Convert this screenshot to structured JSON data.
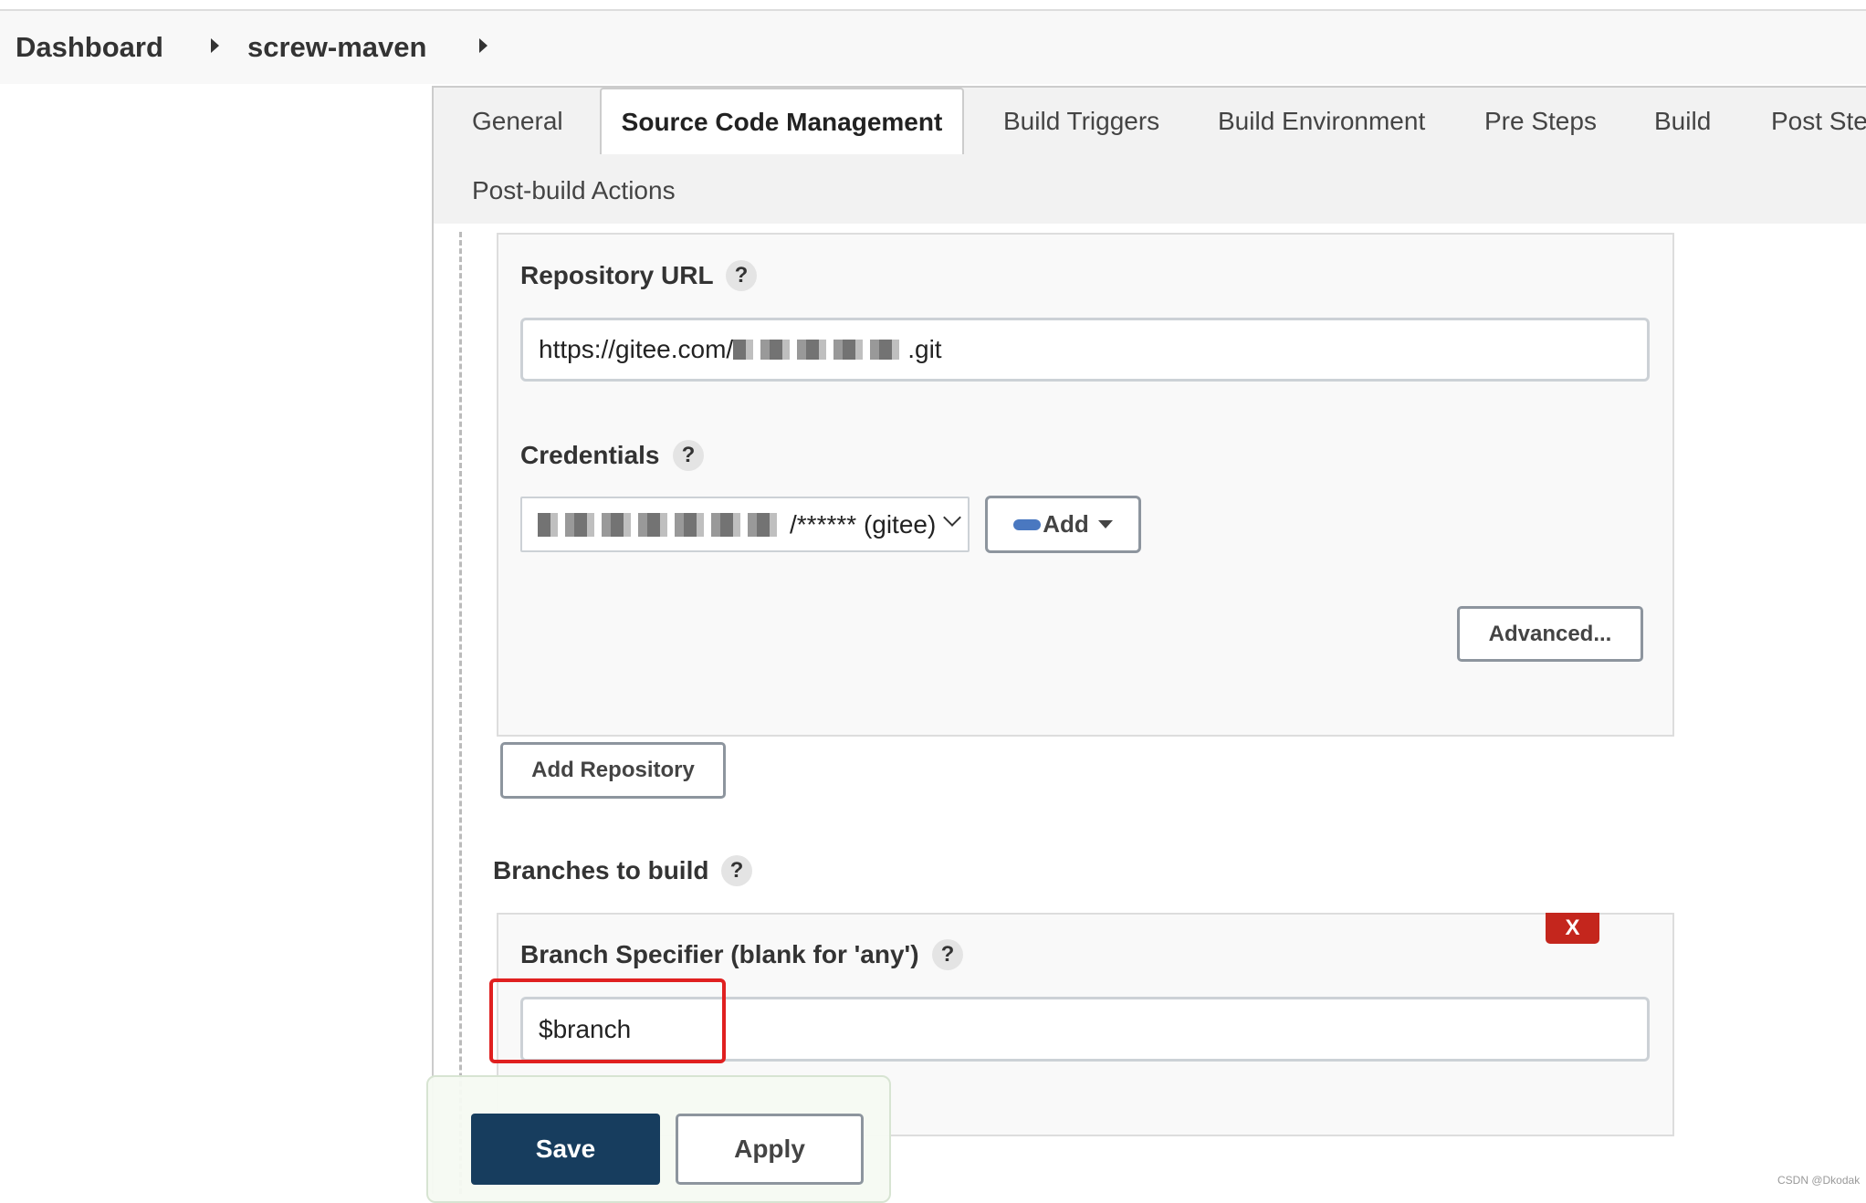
{
  "breadcrumb": {
    "items": [
      "Dashboard",
      "screw-maven"
    ]
  },
  "tabs": {
    "items": [
      "General",
      "Source Code Management",
      "Build Triggers",
      "Build Environment",
      "Pre Steps",
      "Build",
      "Post Ste",
      "Post-build Actions"
    ],
    "active": "Source Code Management"
  },
  "repository": {
    "url_label": "Repository URL",
    "url_value_prefix": "https://gitee.com/",
    "url_value_suffix": ".git",
    "credentials_label": "Credentials",
    "credentials_value": "/****** (gitee)",
    "add_label": "Add",
    "advanced_label": "Advanced..."
  },
  "add_repository_label": "Add Repository",
  "branches": {
    "title": "Branches to build",
    "delete_label": "X",
    "specifier_label": "Branch Specifier (blank for 'any')",
    "specifier_value": "$branch"
  },
  "help_symbol": "?",
  "footer": {
    "save_label": "Save",
    "apply_label": "Apply"
  },
  "watermark": "CSDN @Dkodak",
  "colors": {
    "save": "#173d5e",
    "delete": "#c4261d",
    "highlight": "#e02020"
  }
}
